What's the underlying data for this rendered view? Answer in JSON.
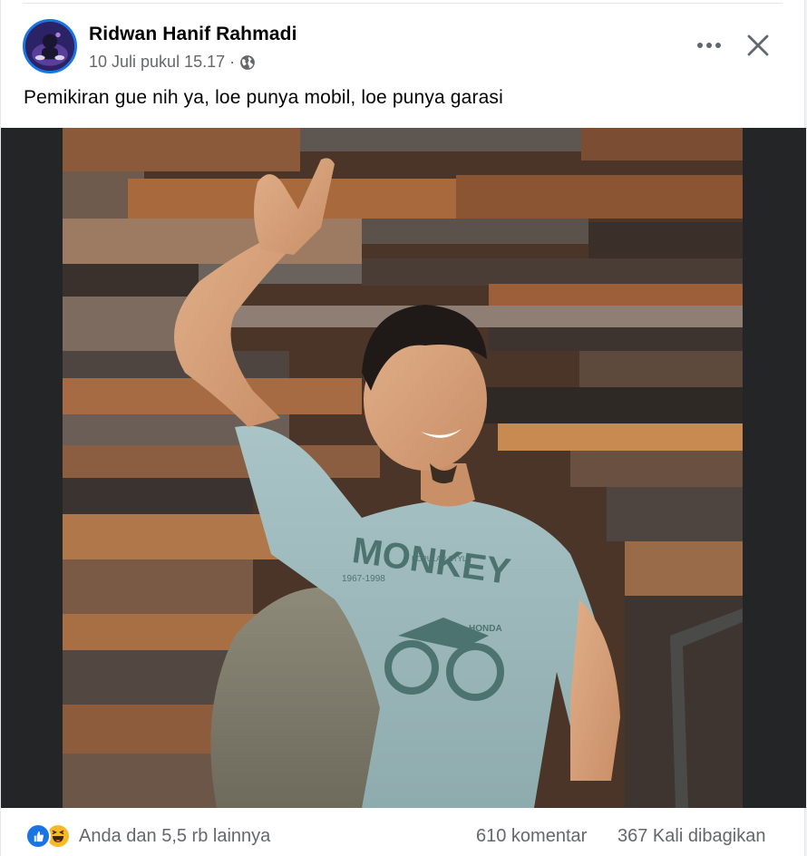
{
  "post": {
    "author": "Ridwan Hanif Rahmadi",
    "date": "10 Juli pukul 15.17",
    "separator": "·",
    "privacy_icon": "globe-icon",
    "text": "Pemikiran gue nih ya, loe punya mobil, loe punya garasi",
    "photo": {
      "shirt_text": "MONKEY",
      "shirt_small_text": "POPULAR STYLE",
      "shirt_years": "1967-1998",
      "shirt_brand": "HONDA"
    }
  },
  "header_actions": {
    "more_icon": "more-options-icon",
    "close_icon": "close-icon"
  },
  "footer": {
    "reactions_text": "Anda dan 5,5 rb lainnya",
    "reaction_icons": [
      "like-icon",
      "haha-icon"
    ],
    "comments": "610 komentar",
    "shares": "367 Kali dibagikan"
  },
  "colors": {
    "brand_blue": "#1b74e4",
    "text_primary": "#050505",
    "text_secondary": "#65676b",
    "haha_yellow": "#f7b928"
  }
}
